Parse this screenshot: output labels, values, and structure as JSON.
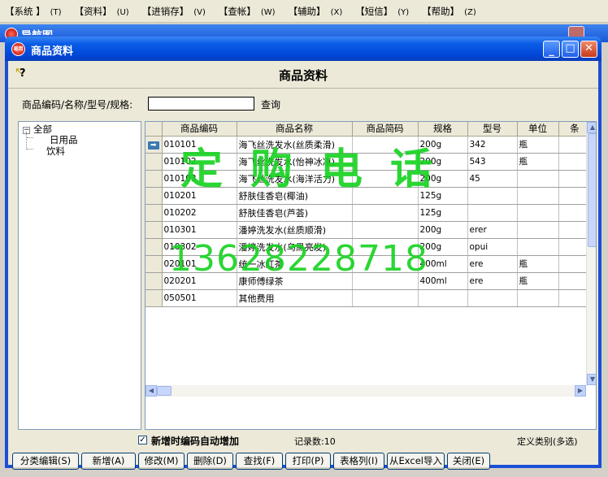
{
  "menu": [
    {
      "label": "【系统 】",
      "key": "(T)"
    },
    {
      "label": "【资料】",
      "key": "(U)"
    },
    {
      "label": "【进销存】",
      "key": "(V)"
    },
    {
      "label": "【查帐】",
      "key": "(W)"
    },
    {
      "label": "【辅助】",
      "key": "(X)"
    },
    {
      "label": "【短信】",
      "key": "(Y)"
    },
    {
      "label": "【帮助】",
      "key": "(Z)"
    }
  ],
  "background_window": {
    "title": "导航图"
  },
  "window": {
    "icon_text": "易用",
    "title": "商品资料",
    "heading": "商品资料"
  },
  "search": {
    "label": "商品编码/名称/型号/规格:",
    "value": "",
    "button": "查询"
  },
  "tree": {
    "root": "全部",
    "children": [
      "日用品",
      "饮料"
    ]
  },
  "grid": {
    "columns": [
      "商品编码",
      "商品名称",
      "商品简码",
      "规格",
      "型号",
      "单位",
      "条"
    ],
    "rows": [
      [
        "010101",
        "海飞丝洗发水(丝质柔滑)",
        "",
        "200g",
        "342",
        "瓶",
        ""
      ],
      [
        "010102",
        "海飞丝洗发水(怡神冰凉)",
        "",
        "200g",
        "543",
        "瓶",
        ""
      ],
      [
        "010103",
        "海飞丝洗发水(海洋活力)",
        "",
        "200g",
        "45",
        "",
        ""
      ],
      [
        "010201",
        "舒肤佳香皂(椰油)",
        "",
        "125g",
        "",
        "",
        ""
      ],
      [
        "010202",
        "舒肤佳香皂(芦荟)",
        "",
        "125g",
        "",
        "",
        ""
      ],
      [
        "010301",
        "潘婷洗发水(丝质顺滑)",
        "",
        "200g",
        "erer",
        "",
        ""
      ],
      [
        "010302",
        "潘婷洗发水(乌黑亮发)",
        "",
        "200g",
        "opui",
        "",
        ""
      ],
      [
        "020101",
        "统一冰红茶",
        "",
        "400ml",
        "ere",
        "瓶",
        ""
      ],
      [
        "020201",
        "康师傅绿茶",
        "",
        "400ml",
        "ere",
        "瓶",
        ""
      ],
      [
        "050501",
        "其他费用",
        "",
        "",
        "",
        "",
        ""
      ]
    ],
    "current_row": 0
  },
  "watermark": {
    "text": "定购电话",
    "phone": "13628228718",
    "color": "#14d21e"
  },
  "status": {
    "auto_code_label": "新增时编码自动增加",
    "auto_code_checked": true,
    "record_count": "记录数:10",
    "define_category": "定义类别(多选)"
  },
  "buttons": [
    "分类编辑(S)",
    "新增(A)",
    "修改(M)",
    "删除(D)",
    "查找(F)",
    "打印(P)",
    "表格列(I)",
    "从Excel导入",
    "关闭(E)"
  ]
}
